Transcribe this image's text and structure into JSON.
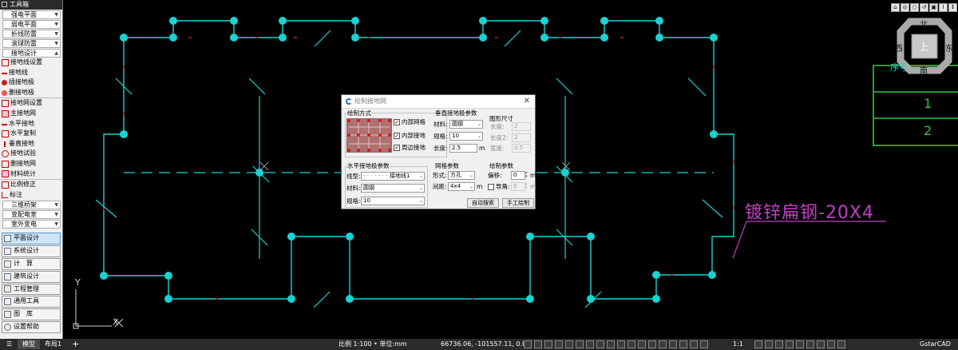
{
  "toolbox": {
    "title": "工具箱",
    "categories_top": [
      "强电平面",
      "弱电平面",
      "折线防雷",
      "滚球防雷",
      "接地设计"
    ],
    "tools": [
      "接地线设置",
      "接地线",
      "插接地极",
      "删接地极",
      "接地网设置",
      "主接地网",
      "水平接地",
      "水平复制",
      "垂直接地",
      "接地试验",
      "删接地网",
      "材料统计",
      "比例修正",
      "标注"
    ],
    "categories_bottom": [
      "三维桥架",
      "变配电室",
      "室外变电"
    ],
    "modules": [
      "平面设计",
      "系统设计",
      "计　算",
      "建筑设计",
      "工程管理",
      "通用工具",
      "图　库",
      "设置帮助"
    ],
    "active_module": "平面设计"
  },
  "compass": {
    "north": "北",
    "south": "南",
    "east": "东",
    "west": "西",
    "center": "上"
  },
  "table": {
    "header": "序号",
    "rows": [
      "1",
      "2"
    ]
  },
  "annotation": "镀锌扁钢-20X4",
  "ucs": {
    "x": "X",
    "y": "Y"
  },
  "top_icons": [
    "⌂",
    "◎",
    "○",
    "↺",
    "▣",
    "I",
    "↕",
    "⇔"
  ],
  "dialog": {
    "title": "绘制接地网",
    "close": "✕",
    "method_group": "绘制方式",
    "checks": [
      {
        "label": "内部网格",
        "checked": true
      },
      {
        "label": "内部接地",
        "checked": true
      },
      {
        "label": "周边接地",
        "checked": true
      }
    ],
    "vertical_group": "垂直接地极参数",
    "v_material_label": "材料:",
    "v_material": "圆钢",
    "v_spec_label": "规格:",
    "v_spec": "10",
    "v_length_label": "长度:",
    "v_length": "2.5",
    "v_length_unit": "m",
    "shape_group": "图形尺寸",
    "len_label": "长度:",
    "len_value": "2",
    "len2_label": "长度2:",
    "len2_value": "2",
    "width_label": "宽度:",
    "width_value": "0.5",
    "horizontal_group": "水平接地极参数",
    "h_linetype_label": "线型:",
    "h_linetype": "接地线1",
    "h_material_label": "材料:",
    "h_material": "圆钢",
    "h_spec_label": "规格:",
    "h_spec": "10",
    "grid_group": "网格参数",
    "form_label": "形式:",
    "form_value": "方孔",
    "spacing_label": "间距:",
    "spacing_value": "4x4",
    "spacing_unit": "m",
    "draw_group": "绘制参数",
    "offset_label": "偏移:",
    "offset_value": "0",
    "offset_unit": "m",
    "fillet_label": "导角:",
    "fillet_value": "0",
    "fillet_unit": "m",
    "btn_auto": "自动搜索",
    "btn_manual": "手工绘制"
  },
  "status": {
    "menu": "☰",
    "tabs": [
      "模型",
      "布局1"
    ],
    "add": "+",
    "scale": "比例 1:100 • 单位:mm",
    "coords": "66736.06, -101557.11, 0.00",
    "zoom": "1:1",
    "app": "GstarCAD"
  },
  "colors": {
    "grid": "#19d2d2",
    "annotation": "#c040c0",
    "table": "#28c840",
    "cut": "#d02020",
    "background": "#000000"
  }
}
